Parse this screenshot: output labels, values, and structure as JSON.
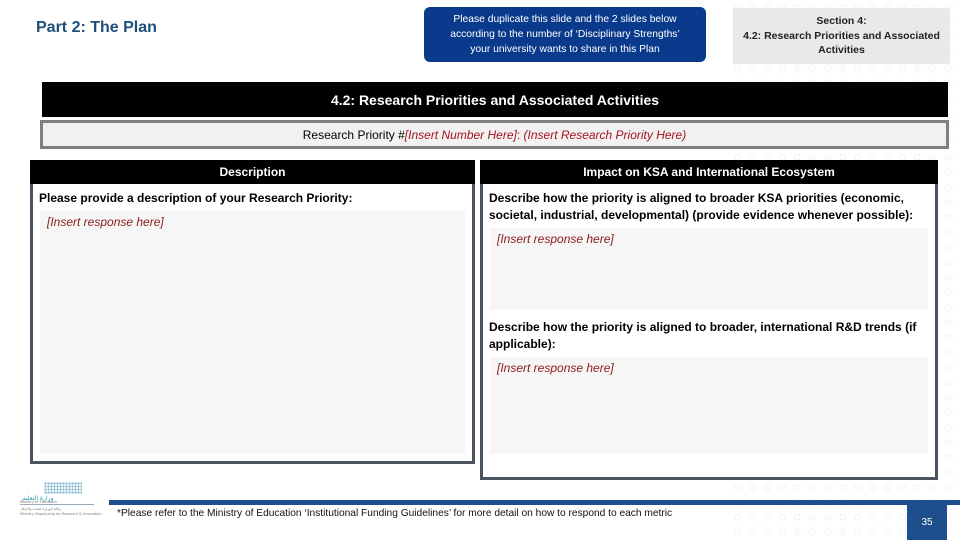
{
  "header": {
    "part_title": "Part 2: The Plan",
    "note": {
      "line1": "Please duplicate this slide and the 2 slides below",
      "line2": "according to the number of ‘Disciplinary Strengths’",
      "line3": "your university wants to share in this Plan"
    },
    "section": {
      "line1": "Section 4:",
      "line2": "4.2: Research Priorities and Associated",
      "line3": "Activities"
    }
  },
  "banner": {
    "title": "4.2: Research Priorities and Associated Activities"
  },
  "priority": {
    "label": "Research Priority #",
    "number_placeholder": "[Insert Number Here]",
    "separator": ": ",
    "priority_placeholder": "(Insert Research Priority Here)"
  },
  "description_panel": {
    "header": "Description",
    "prompt": "Please provide a description of your Research Priority:",
    "response": "[Insert response here]"
  },
  "impact_panel": {
    "header": "Impact on KSA and International Ecosystem",
    "prompt1": "Describe how the priority is aligned to broader KSA priorities (economic, societal, industrial, developmental) (provide evidence whenever possible):",
    "response1": "[Insert response here]",
    "prompt2": "Describe how the priority is aligned to broader, international R&D trends (if applicable):",
    "response2": "[Insert response here]"
  },
  "footer": {
    "logo": {
      "arabic": "وزارة التعليم",
      "english": "Ministry of Education",
      "sub1": "وكالة الوزارة للبحث والابتكار",
      "sub2": "Ministry Deputyship for Research & Innovation"
    },
    "footnote": "*Please refer to the Ministry of Education ‘Institutional Funding Guidelines’ for more detail on how to respond to each metric",
    "page_number": "35"
  },
  "colors": {
    "navy": "#1f4e79",
    "note_blue": "#0a3a8c",
    "footer_blue": "#1f4e8c",
    "placeholder_red": "#a5121d",
    "panel_border": "#4a5561"
  }
}
